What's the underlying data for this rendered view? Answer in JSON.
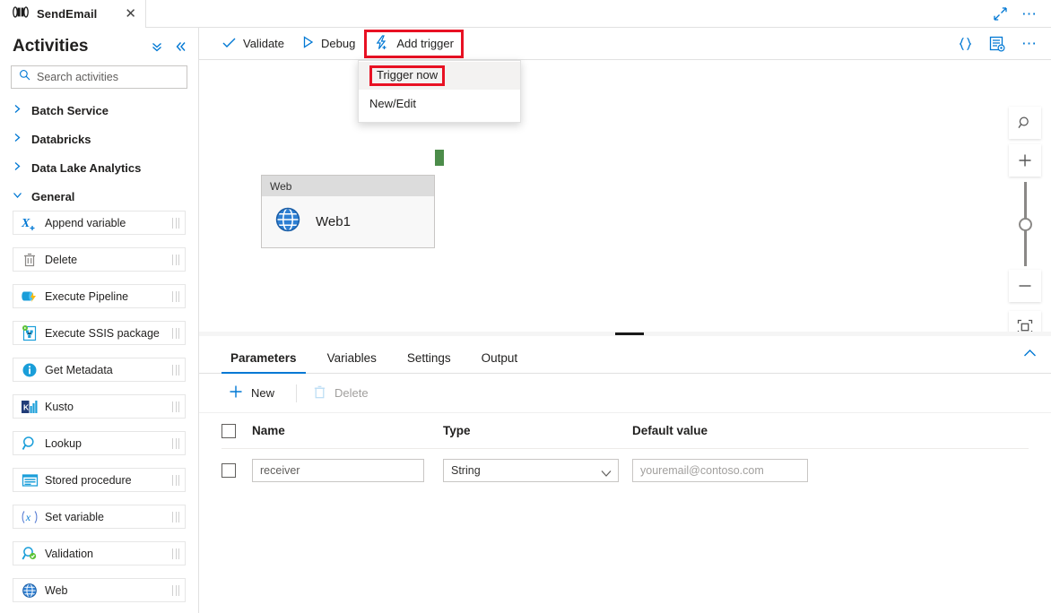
{
  "tabbar": {
    "pipeline_name": "SendEmail",
    "pipeline_icon": "pipeline-icon",
    "close_icon": "close-icon",
    "expand_icon": "expand-diagonal-icon",
    "more_icon": "ellipsis-icon"
  },
  "sidebar": {
    "title": "Activities",
    "collapse_all_icon": "double-chevron-down-icon",
    "collapse_pane_icon": "double-chevron-left-icon",
    "search": {
      "placeholder": "Search activities",
      "value": "",
      "icon": "search-icon"
    },
    "categories": [
      {
        "label": "Batch Service",
        "expanded": false
      },
      {
        "label": "Databricks",
        "expanded": false
      },
      {
        "label": "Data Lake Analytics",
        "expanded": false
      },
      {
        "label": "General",
        "expanded": true
      }
    ],
    "activities": [
      {
        "label": "Append variable",
        "icon": "append-variable-icon"
      },
      {
        "label": "Delete",
        "icon": "trash-icon"
      },
      {
        "label": "Execute Pipeline",
        "icon": "execute-pipeline-icon"
      },
      {
        "label": "Execute SSIS package",
        "icon": "ssis-package-icon"
      },
      {
        "label": "Get Metadata",
        "icon": "info-icon"
      },
      {
        "label": "Kusto",
        "icon": "kusto-icon"
      },
      {
        "label": "Lookup",
        "icon": "magnifier-icon"
      },
      {
        "label": "Stored procedure",
        "icon": "stored-procedure-icon"
      },
      {
        "label": "Set variable",
        "icon": "set-variable-icon"
      },
      {
        "label": "Validation",
        "icon": "validation-icon"
      },
      {
        "label": "Web",
        "icon": "globe-icon"
      }
    ]
  },
  "commandbar": {
    "validate": {
      "label": "Validate",
      "icon": "checkmark-icon"
    },
    "debug": {
      "label": "Debug",
      "icon": "play-icon"
    },
    "add_trigger": {
      "label": "Add trigger",
      "icon": "trigger-bolt-icon",
      "highlighted": true
    },
    "code_icon": "curly-braces-icon",
    "properties_icon": "properties-icon",
    "more_icon": "ellipsis-icon"
  },
  "trigger_menu": {
    "open": true,
    "items": [
      {
        "label": "Trigger now",
        "highlighted": true,
        "hover": true
      },
      {
        "label": "New/Edit",
        "highlighted": false,
        "hover": false
      }
    ]
  },
  "canvas": {
    "node": {
      "type": "Web",
      "name": "Web1",
      "icon": "globe-icon",
      "output_connector_color": "#4c8c4a"
    },
    "zoom_controls": {
      "search_icon": "zoom-search-icon",
      "zoom_in_icon": "plus-icon",
      "zoom_out_icon": "minus-icon",
      "fit_icon": "fit-to-screen-icon"
    }
  },
  "bottom_panel": {
    "tabs": [
      {
        "label": "Parameters",
        "active": true
      },
      {
        "label": "Variables",
        "active": false
      },
      {
        "label": "Settings",
        "active": false
      },
      {
        "label": "Output",
        "active": false
      }
    ],
    "collapse_icon": "chevron-up-icon",
    "actions": {
      "new": {
        "label": "New",
        "icon": "plus-icon",
        "disabled": false
      },
      "delete": {
        "label": "Delete",
        "icon": "trash-icon",
        "disabled": true
      }
    },
    "table": {
      "headers": {
        "name": "Name",
        "type": "Type",
        "default_value": "Default value"
      },
      "rows": [
        {
          "checked": false,
          "name": "receiver",
          "type": "String",
          "default_value_placeholder": "youremail@contoso.com",
          "default_value": ""
        }
      ]
    }
  },
  "colors": {
    "accent": "#0078d4",
    "highlight_red": "#e81123",
    "connector_green": "#4c8c4a"
  }
}
